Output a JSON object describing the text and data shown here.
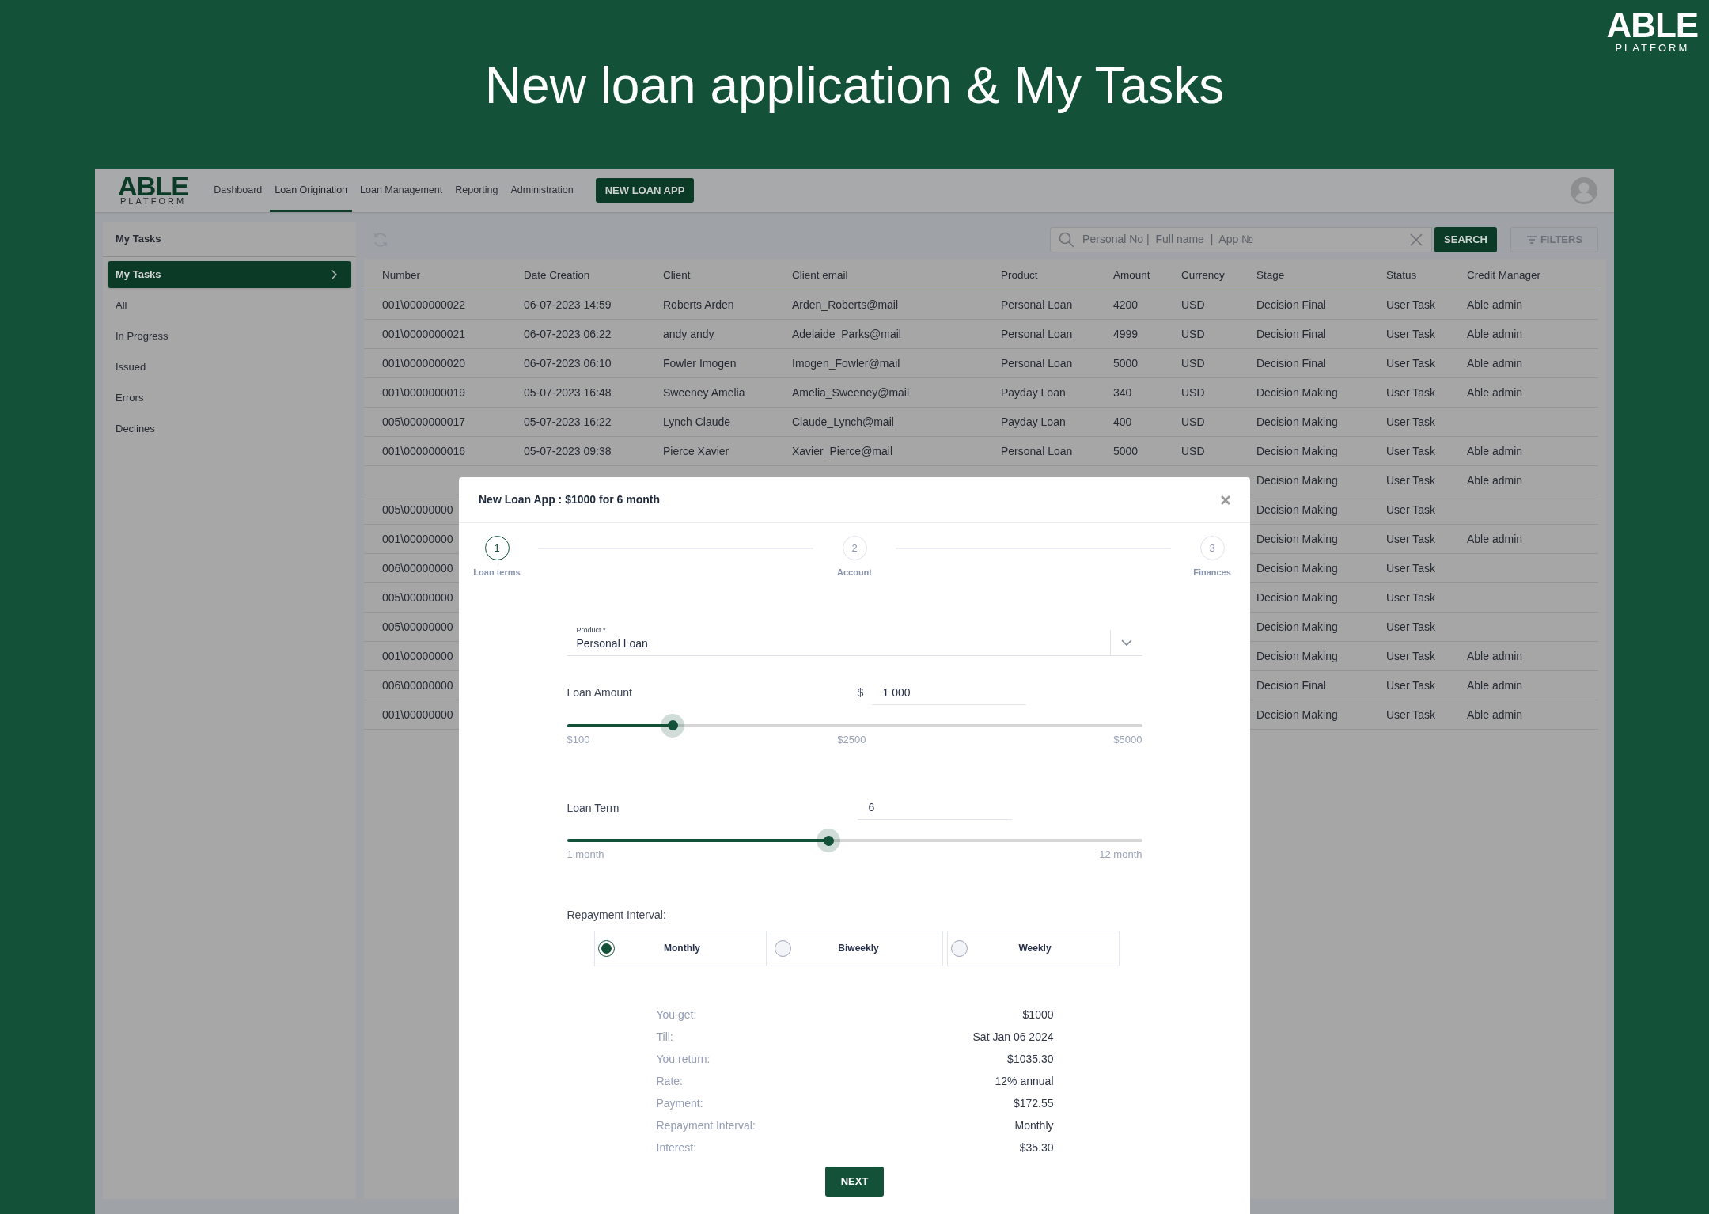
{
  "slide": {
    "title": "New loan application & My Tasks",
    "logo": {
      "wordmark": "ABLE",
      "tagline": "PLATFORM"
    }
  },
  "app": {
    "logo": {
      "wordmark": "ABLE",
      "tagline": "PLATFORM"
    },
    "nav": [
      {
        "label": "Dashboard",
        "selected": false
      },
      {
        "label": "Loan Origination",
        "selected": true
      },
      {
        "label": "Loan Management",
        "selected": false
      },
      {
        "label": "Reporting",
        "selected": false
      },
      {
        "label": "Administration",
        "selected": false
      }
    ],
    "new_loan_button": "NEW LOAN APP"
  },
  "sidebar": {
    "heading": "My Tasks",
    "items": [
      {
        "label": "My Tasks",
        "selected": true
      },
      {
        "label": "All",
        "selected": false
      },
      {
        "label": "In Progress",
        "selected": false
      },
      {
        "label": "Issued",
        "selected": false
      },
      {
        "label": "Errors",
        "selected": false
      },
      {
        "label": "Declines",
        "selected": false
      }
    ]
  },
  "search": {
    "placeholder": "Personal No |  Full name  |  App №",
    "button": "SEARCH",
    "filters": "FILTERS"
  },
  "table": {
    "columns": [
      "Number",
      "Date Creation",
      "Client",
      "Client email",
      "Product",
      "Amount",
      "Currency",
      "Stage",
      "Status",
      "Credit Manager"
    ],
    "rows": [
      {
        "number": "001\\0000000022",
        "date_creation": "06-07-2023 14:59",
        "client": "Roberts Arden",
        "client_email": "Arden_Roberts@mail",
        "product": "Personal Loan",
        "amount": "4200",
        "currency": "USD",
        "stage": "Decision Final",
        "status": "User Task",
        "credit_manager": "Able admin"
      },
      {
        "number": "001\\0000000021",
        "date_creation": "06-07-2023 06:22",
        "client": "andy andy",
        "client_email": "Adelaide_Parks@mail",
        "product": "Personal Loan",
        "amount": "4999",
        "currency": "USD",
        "stage": "Decision Final",
        "status": "User Task",
        "credit_manager": "Able admin"
      },
      {
        "number": "001\\0000000020",
        "date_creation": "06-07-2023 06:10",
        "client": "Fowler Imogen",
        "client_email": "Imogen_Fowler@mail",
        "product": "Personal Loan",
        "amount": "5000",
        "currency": "USD",
        "stage": "Decision Final",
        "status": "User Task",
        "credit_manager": "Able admin"
      },
      {
        "number": "001\\0000000019",
        "date_creation": "05-07-2023 16:48",
        "client": "Sweeney Amelia",
        "client_email": "Amelia_Sweeney@mail",
        "product": "Payday Loan",
        "amount": "340",
        "currency": "USD",
        "stage": "Decision Making",
        "status": "User Task",
        "credit_manager": "Able admin"
      },
      {
        "number": "005\\0000000017",
        "date_creation": "05-07-2023 16:22",
        "client": "Lynch Claude",
        "client_email": "Claude_Lynch@mail",
        "product": "Payday Loan",
        "amount": "400",
        "currency": "USD",
        "stage": "Decision Making",
        "status": "User Task"
      },
      {
        "number": "001\\0000000016",
        "date_creation": "05-07-2023 09:38",
        "client": "Pierce Xavier",
        "client_email": "Xavier_Pierce@mail",
        "product": "Personal Loan",
        "amount": "5000",
        "currency": "USD",
        "stage": "Decision Making",
        "status": "User Task",
        "credit_manager": "Able admin"
      },
      {
        "stage": "Decision Making",
        "status": "User Task",
        "credit_manager": "Able admin"
      },
      {
        "number": "005\\00000000",
        "stage": "Decision Making",
        "status": "User Task"
      },
      {
        "number": "001\\00000000",
        "stage": "Decision Making",
        "status": "User Task",
        "credit_manager": "Able admin"
      },
      {
        "number": "006\\00000000",
        "stage": "Decision Making",
        "status": "User Task"
      },
      {
        "number": "005\\00000000",
        "stage": "Decision Making",
        "status": "User Task"
      },
      {
        "number": "005\\00000000",
        "stage": "Decision Making",
        "status": "User Task"
      },
      {
        "number": "001\\00000000",
        "stage": "Decision Making",
        "status": "User Task",
        "credit_manager": "Able admin"
      },
      {
        "number": "006\\00000000",
        "stage": "Decision Final",
        "status": "User Task",
        "credit_manager": "Able admin"
      },
      {
        "number": "001\\00000000",
        "stage": "Decision Making",
        "status": "User Task",
        "credit_manager": "Able admin"
      }
    ]
  },
  "modal": {
    "title": "New Loan App : $1000 for 6 month",
    "steps": [
      {
        "number": "1",
        "label": "Loan terms",
        "selected": true
      },
      {
        "number": "2",
        "label": "Account",
        "selected": false
      },
      {
        "number": "3",
        "label": "Finances",
        "selected": false
      }
    ],
    "product": {
      "label": "Product",
      "required_mark": "*",
      "value": "Personal Loan"
    },
    "loan_amount": {
      "label": "Loan Amount",
      "currency": "$",
      "value": "1 000",
      "level": 0.184,
      "ticks": [
        "$100",
        "$2500",
        "$5000"
      ]
    },
    "loan_term": {
      "label": "Loan Term",
      "value": "6",
      "level": 0.455,
      "ticks": [
        "1 month",
        "12 month"
      ]
    },
    "repayment_interval": {
      "label": "Repayment Interval:",
      "options": [
        {
          "label": "Monthly",
          "selected": true
        },
        {
          "label": "Biweekly",
          "selected": false
        },
        {
          "label": "Weekly",
          "selected": false
        }
      ]
    },
    "summary": [
      {
        "label": "You get:",
        "value": "$1000"
      },
      {
        "label": "Till:",
        "value": "Sat Jan 06 2024"
      },
      {
        "label": "You return:",
        "value": "$1035.30"
      },
      {
        "label": "Rate:",
        "value": "12% annual"
      },
      {
        "label": "Payment:",
        "value": "$172.55"
      },
      {
        "label": "Repayment Interval:",
        "value": "Monthly"
      },
      {
        "label": "Interest:",
        "value": "$35.30"
      }
    ],
    "next_button": "NEXT"
  }
}
